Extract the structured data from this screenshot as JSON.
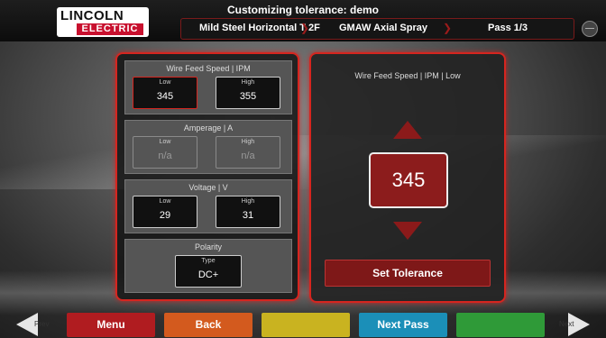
{
  "header": {
    "title": "Customizing tolerance: demo",
    "logo_top": "LINCOLN",
    "logo_bottom": "ELECTRIC",
    "breadcrumbs": [
      "Mild Steel Horizontal T 2F",
      "GMAW Axial Spray",
      "Pass 1/3"
    ]
  },
  "groups": [
    {
      "title": "Wire Feed Speed | IPM",
      "low_label": "Low",
      "low": "345",
      "high_label": "High",
      "high": "355"
    },
    {
      "title": "Amperage | A",
      "low_label": "Low",
      "low": "n/a",
      "high_label": "High",
      "high": "n/a"
    },
    {
      "title": "Voltage | V",
      "low_label": "Low",
      "low": "29",
      "high_label": "High",
      "high": "31"
    },
    {
      "title": "Polarity",
      "type_label": "Type",
      "type": "DC+"
    }
  ],
  "editor": {
    "label": "Wire Feed Speed | IPM | Low",
    "value": "345",
    "set_button": "Set Tolerance"
  },
  "footer": {
    "prev": "Prev",
    "menu": "Menu",
    "back": "Back",
    "blank_yellow": "",
    "next_pass": "Next Pass",
    "blank_green": "",
    "next": "Next"
  },
  "colors": {
    "accent_red": "#d6251f",
    "menu": "#b01c20",
    "back": "#d35a1e",
    "yellow": "#c9b320",
    "next_pass": "#1b8fb8",
    "green": "#2f9a38"
  }
}
